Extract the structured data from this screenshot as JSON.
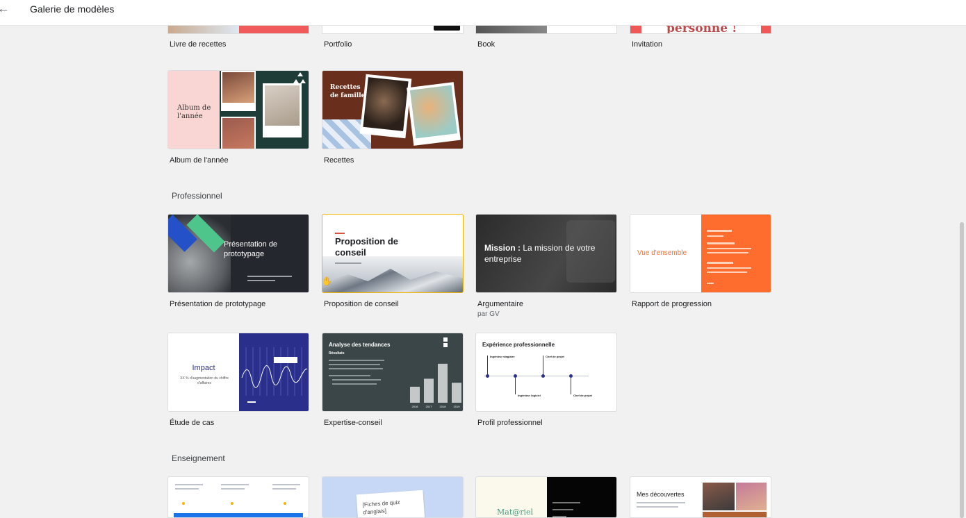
{
  "header": {
    "back_icon": "←",
    "title": "Galerie de modèles"
  },
  "rows": {
    "personal_top": [
      {
        "name": "Livre de recettes"
      },
      {
        "name": "Portfolio"
      },
      {
        "name": "Book"
      },
      {
        "name": "Invitation",
        "thumb_text": "personne !"
      }
    ],
    "personal_second": [
      {
        "name": "Album de l'année",
        "thumb_text": "Album de l'année"
      },
      {
        "name": "Recettes",
        "thumb_text": "Recettes de famille"
      }
    ]
  },
  "sections": {
    "professionnel": {
      "title": "Professionnel",
      "row1": [
        {
          "name": "Présentation de prototypage",
          "thumb_text": "Présentation de prototypage"
        },
        {
          "name": "Proposition de conseil",
          "thumb_text": "Proposition de conseil"
        },
        {
          "name": "Argumentaire",
          "author": "par GV",
          "thumb_bold": "Mission :",
          "thumb_text": "La mission de votre entreprise"
        },
        {
          "name": "Rapport de progression",
          "thumb_text": "Vue d'ensemble"
        }
      ],
      "row2": [
        {
          "name": "Étude de cas",
          "thumb_title": "Impact",
          "thumb_text": "XX % d'augmentation du chiffre d'affaires"
        },
        {
          "name": "Expertise-conseil",
          "thumb_title": "Analyse des tendances",
          "thumb_sub": "Résultats",
          "bar_values": [
            32,
            48,
            78,
            40
          ],
          "bar_years": [
            "2016",
            "2017",
            "2018",
            "2019"
          ]
        },
        {
          "name": "Profil professionnel",
          "thumb_title": "Expérience professionnelle",
          "timeline": [
            "Ingénieur stagiaire",
            "Ingénieur logiciel",
            "Chef de projet",
            "Chef de projet"
          ]
        }
      ]
    },
    "enseignement": {
      "title": "Enseignement",
      "row1": [
        {
          "name": ""
        },
        {
          "name": "",
          "thumb_text": "[Fiches de quiz d'anglais]"
        },
        {
          "name": "",
          "thumb_text": "Mat@riel"
        },
        {
          "name": "",
          "thumb_text": "Mes découvertes"
        }
      ]
    }
  },
  "colors": {
    "accent_orange": "#ff6d2e",
    "invite_red": "#f05858",
    "case_blue": "#2a2f8c",
    "dark_slate": "#3b4649"
  }
}
